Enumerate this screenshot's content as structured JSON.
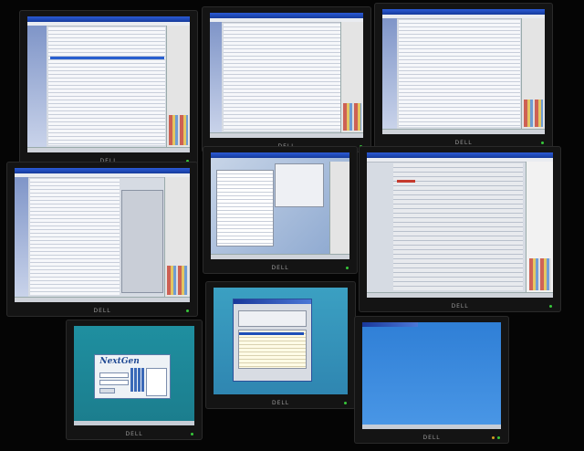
{
  "scene": {
    "description_free": true,
    "brand": "DELL",
    "monitors": [
      {
        "id": "m1",
        "screen": "app"
      },
      {
        "id": "m2",
        "screen": "app"
      },
      {
        "id": "m3",
        "screen": "app"
      },
      {
        "id": "m4",
        "screen": "app"
      },
      {
        "id": "m5",
        "screen": "app"
      },
      {
        "id": "m6",
        "screen": "app"
      },
      {
        "id": "m7",
        "screen": "login",
        "logo": "NextGen"
      },
      {
        "id": "m8",
        "screen": "dialog"
      },
      {
        "id": "m9",
        "screen": "desktop"
      }
    ]
  },
  "colors": {
    "background": "#050505",
    "bezel": "#141414",
    "titlebar": "#2b5bd6",
    "login_bg": "#1f8fa0",
    "desktop_bg": "#2f7fd6"
  }
}
